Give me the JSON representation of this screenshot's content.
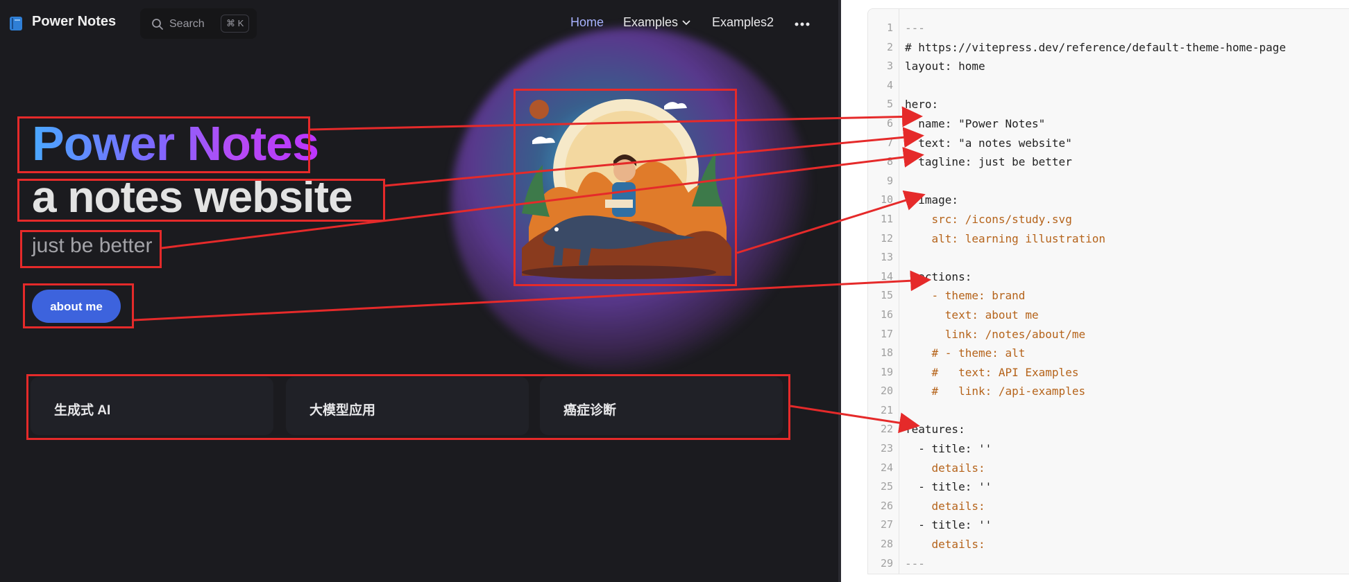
{
  "nav": {
    "logo_icon": "book-icon",
    "title": "Power Notes",
    "search_label": "Search",
    "search_shortcut": "⌘ K",
    "links": [
      "Home",
      "Examples",
      "Examples2"
    ],
    "more_icon": "ellipsis-icon"
  },
  "hero": {
    "name": "Power Notes",
    "text": "a notes website",
    "tagline": "just be better",
    "action_label": "about me",
    "image_alt": "learning illustration"
  },
  "features": [
    "生成式 AI",
    "大模型应用",
    "癌症诊断"
  ],
  "editor": {
    "lines": [
      "---",
      "# https://vitepress.dev/reference/default-theme-home-page",
      "layout: home",
      "",
      "hero:",
      "  name: \"Power Notes\"",
      "  text: \"a notes website\"",
      "  tagline: just be better",
      "",
      "  image:",
      "    src: /icons/study.svg",
      "    alt: learning illustration",
      "",
      "  actions:",
      "    - theme: brand",
      "      text: about me",
      "      link: /notes/about/me",
      "    # - theme: alt",
      "    #   text: API Examples",
      "    #   link: /api-examples",
      "",
      "features:",
      "  - title: ''",
      "    details:",
      "  - title: ''",
      "    details:",
      "  - title: ''",
      "    details:",
      "---"
    ],
    "line_numbers": [
      "1",
      "2",
      "3",
      "4",
      "5",
      "6",
      "7",
      "8",
      "9",
      "10",
      "11",
      "12",
      "13",
      "14",
      "15",
      "16",
      "17",
      "18",
      "19",
      "20",
      "21",
      "22",
      "23",
      "24",
      "25",
      "26",
      "27",
      "28",
      "29"
    ]
  },
  "colors": {
    "annotation": "#e52a2a",
    "brand": "#3d63dd",
    "background": "#1b1b1f",
    "yaml_value": "#b5631a"
  }
}
